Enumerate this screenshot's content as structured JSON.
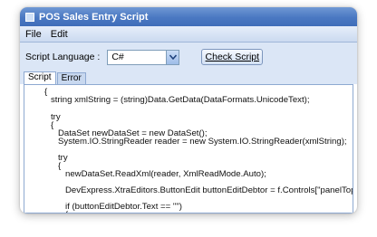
{
  "window": {
    "title": "POS Sales Entry Script"
  },
  "menu": {
    "items": [
      "File",
      "Edit"
    ]
  },
  "toolbar": {
    "language_label": "Script Language :",
    "language_value": "C#",
    "check_button": "Check Script"
  },
  "tabs": [
    {
      "label": "Script",
      "active": true
    },
    {
      "label": "Error",
      "active": false
    }
  ],
  "editor": {
    "lines": [
      "{",
      "string xmlString = (string)Data.GetData(DataFormats.UnicodeText);",
      "try",
      "{",
      "DataSet newDataSet = new DataSet();",
      "System.IO.StringReader reader = new System.IO.StringReader(xmlString);",
      "try",
      "{",
      "newDataSet.ReadXml(reader, XmlReadMode.Auto);",
      "DevExpress.XtraEditors.ButtonEdit buttonEditDebtor = f.Controls[\"panelTop\"].Controls[\"panel",
      "if (buttonEditDebtor.Text == \"\")",
      "{"
    ]
  }
}
